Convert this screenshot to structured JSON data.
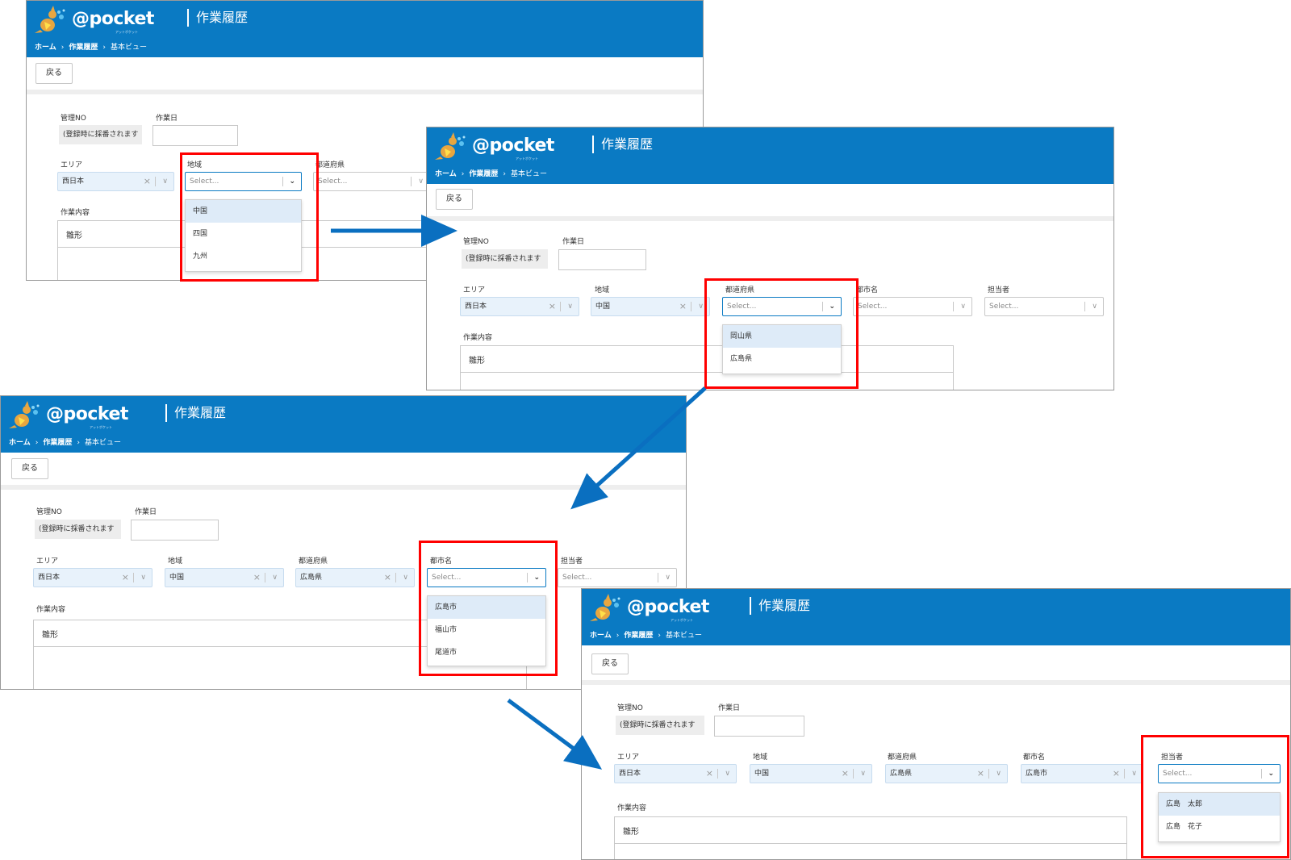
{
  "app": {
    "logo_text": "@pocket",
    "logo_sub": "アットポケット",
    "title": "作業履歴",
    "breadcrumb": {
      "home": "ホーム",
      "sep": "›",
      "section": "作業履歴",
      "current": "基本ビュー"
    },
    "back_label": "戻る"
  },
  "form": {
    "mgmt_no_label": "管理NO",
    "mgmt_no_value": "(登録時に採番されます",
    "work_date_label": "作業日",
    "area_label": "エリア",
    "region_label": "地域",
    "prefecture_label": "都道府県",
    "city_label": "都市名",
    "assignee_label": "担当者",
    "content_label": "作業内容",
    "content_value": "雛形",
    "placeholder": "Select...",
    "area_value": "西日本",
    "region_value": "中国",
    "prefecture_value": "広島県",
    "city_value": "広島市"
  },
  "icons": {
    "clear": "×",
    "caret": "∨",
    "caret_active": "⌄"
  },
  "menus": {
    "region": [
      "中国",
      "四国",
      "九州"
    ],
    "prefecture": [
      "岡山県",
      "広島県"
    ],
    "city": [
      "広島市",
      "福山市",
      "尾道市"
    ],
    "assignee": [
      "広島　太郎",
      "広島　花子"
    ]
  },
  "colors": {
    "header": "#0a7ac3",
    "highlight": "#ff0000",
    "arrow": "#0a6fc0",
    "selected_fill": "#e8f2fb",
    "option_hover": "#deebf8"
  }
}
